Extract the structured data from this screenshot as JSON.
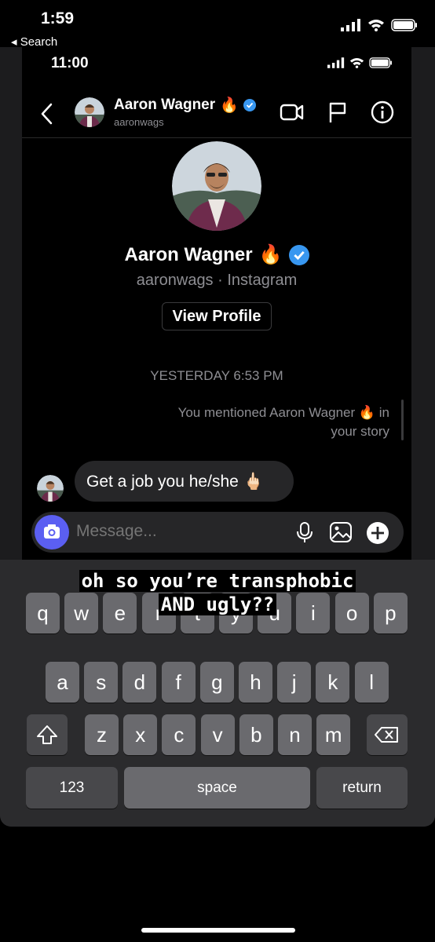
{
  "outer_status": {
    "time": "1:59",
    "back_label": "◂ Search"
  },
  "inner_status": {
    "time": "11:00"
  },
  "header": {
    "name": "Aaron Wagner",
    "handle": "aaronwags"
  },
  "profile": {
    "name": "Aaron Wagner",
    "subtitle": "aaronwags · Instagram",
    "view_button": "View Profile"
  },
  "thread": {
    "timestamp": "YESTERDAY 6:53 PM",
    "mention_note_line1": "You mentioned Aaron Wagner 🔥 in",
    "mention_note_line2": "your story",
    "message_text": "Get a job you he/she 🖕🏻"
  },
  "composer": {
    "placeholder": "Message..."
  },
  "caption": {
    "line1": "oh so you’re transphobic",
    "line2": "AND ugly??"
  },
  "keyboard": {
    "row1": [
      "q",
      "w",
      "e",
      "r",
      "t",
      "y",
      "u",
      "i",
      "o",
      "p"
    ],
    "row2": [
      "a",
      "s",
      "d",
      "f",
      "g",
      "h",
      "j",
      "k",
      "l"
    ],
    "row3": [
      "z",
      "x",
      "c",
      "v",
      "b",
      "n",
      "m"
    ],
    "numbers_label": "123",
    "space_label": "space",
    "return_label": "return"
  },
  "colors": {
    "accent_camera": "#5b5ff2",
    "verified": "#3897f0",
    "bubble": "#262628"
  },
  "icons": [
    "fire-emoji",
    "verified-badge-icon",
    "video-call-icon",
    "flag-icon",
    "info-icon",
    "camera-icon",
    "microphone-icon",
    "gallery-icon",
    "plus-icon",
    "shift-icon",
    "backspace-icon"
  ]
}
